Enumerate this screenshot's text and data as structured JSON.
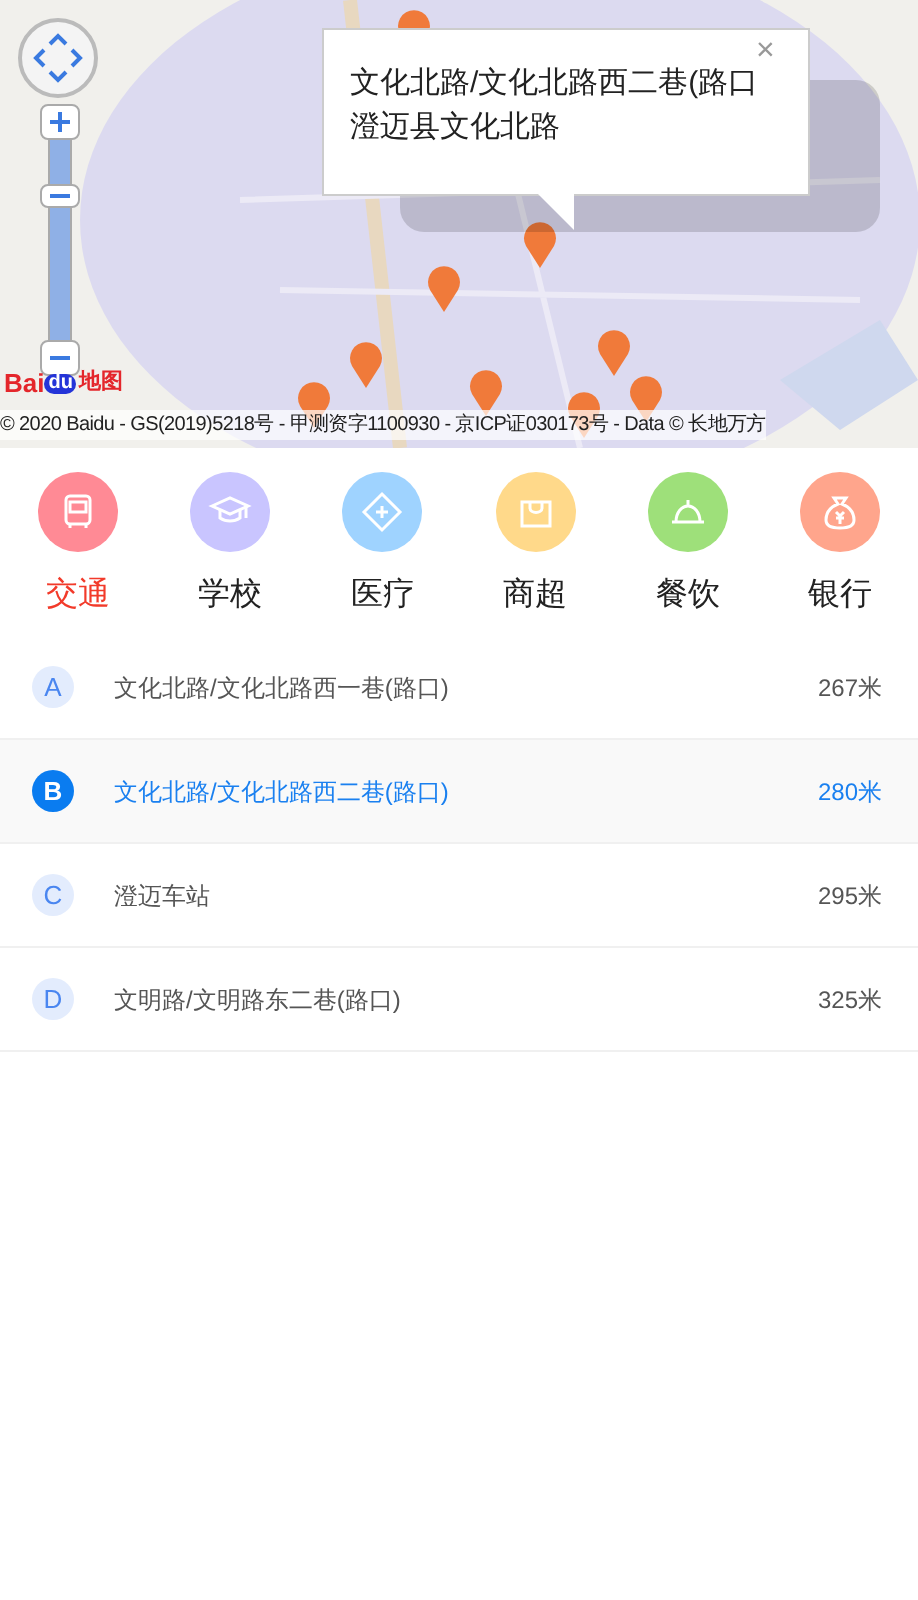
{
  "map": {
    "logo": [
      "Bai",
      "du",
      "地图"
    ],
    "copyright": "© 2020 Baidu - GS(2019)5218号 - 甲测资字1100930 - 京ICP证030173号 - Data © 长地万方",
    "popup": {
      "close": "×",
      "title": "文化北路/文化北路西二巷(路口",
      "address": "澄迈县文化北路"
    }
  },
  "categories": [
    {
      "label": "交通",
      "kind": "bus",
      "color": "#ff8a95",
      "selected": true
    },
    {
      "label": "学校",
      "kind": "school",
      "color": "#c9c5ff",
      "selected": false
    },
    {
      "label": "医疗",
      "kind": "medical",
      "color": "#9fd3ff",
      "selected": false
    },
    {
      "label": "商超",
      "kind": "shop",
      "color": "#ffd98a",
      "selected": false
    },
    {
      "label": "餐饮",
      "kind": "food",
      "color": "#9ee07a",
      "selected": false
    },
    {
      "label": "银行",
      "kind": "bank",
      "color": "#ffa58c",
      "selected": false
    }
  ],
  "places": [
    {
      "letter": "A",
      "name": "文化北路/文化北路西一巷(路口)",
      "distance": "267米",
      "selected": false
    },
    {
      "letter": "B",
      "name": "文化北路/文化北路西二巷(路口)",
      "distance": "280米",
      "selected": true
    },
    {
      "letter": "C",
      "name": "澄迈车站",
      "distance": "295米",
      "selected": false
    },
    {
      "letter": "D",
      "name": "文明路/文明路东二巷(路口)",
      "distance": "325米",
      "selected": false
    }
  ]
}
